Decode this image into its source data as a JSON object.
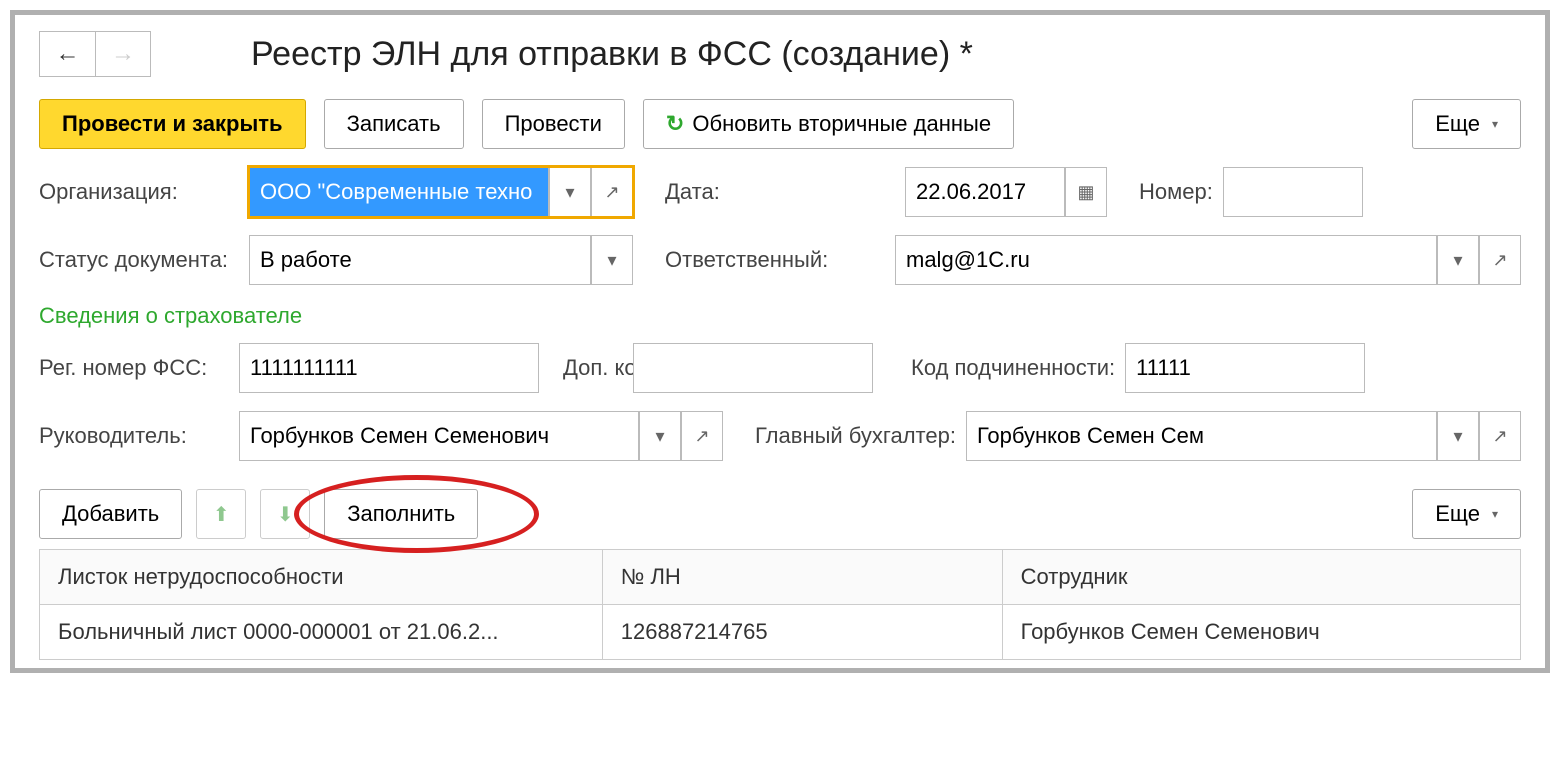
{
  "header": {
    "title": "Реестр ЭЛН для отправки в ФСС (создание) *"
  },
  "toolbar": {
    "post_and_close": "Провести и закрыть",
    "save": "Записать",
    "post": "Провести",
    "refresh": "Обновить вторичные данные",
    "more": "Еще"
  },
  "form": {
    "org_label": "Организация:",
    "org_value": "ООО \"Современные техно",
    "date_label": "Дата:",
    "date_value": "22.06.2017",
    "number_label": "Номер:",
    "number_value": "",
    "status_label": "Статус документа:",
    "status_value": "В работе",
    "responsible_label": "Ответственный:",
    "responsible_value": "malg@1C.ru"
  },
  "insurer": {
    "section_title": "Сведения о страхователе",
    "reg_label": "Рег. номер ФСС:",
    "reg_value": "1111111111",
    "dop_label": "Доп. код:",
    "dop_value": "",
    "sub_label": "Код подчиненности:",
    "sub_value": "11111",
    "manager_label": "Руководитель:",
    "manager_value": "Горбунков Семен Семенович",
    "accountant_label": "Главный бухгалтер:",
    "accountant_value": "Горбунков Семен Сем"
  },
  "table_toolbar": {
    "add": "Добавить",
    "fill": "Заполнить",
    "more": "Еще"
  },
  "table": {
    "columns": [
      "Листок нетрудоспособности",
      "№ ЛН",
      "Сотрудник"
    ],
    "rows": [
      [
        "Больничный лист 0000-000001 от 21.06.2...",
        "126887214765",
        "Горбунков Семен Семенович"
      ]
    ]
  }
}
